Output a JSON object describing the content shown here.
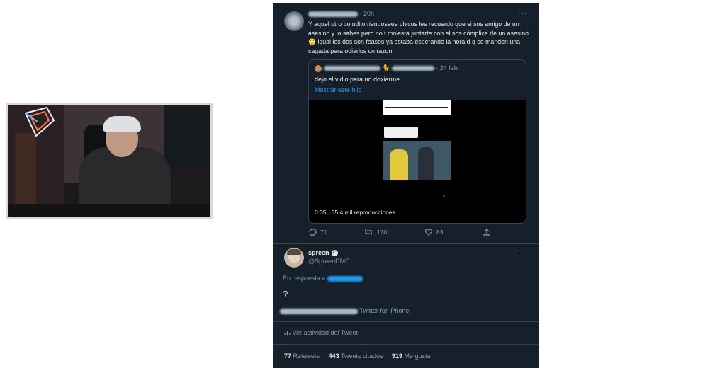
{
  "webcam": {
    "description_icon": "webcam-overlay"
  },
  "tweet": {
    "time": "· 20h",
    "text": "Y aquel otro boludito riendoseee chicos les recuerdo que si sos amigo de un asesino y lo sabes pero no t molesta juntarte con el sos cómplice de un asesino 🙄 igual los dos son feasos ya estaba esperando la hora d q se manden una cagada para odiarlos cn razon",
    "quote": {
      "date": "· 24 feb.",
      "emoji": "🐈",
      "text": "dejo el vidio para no doxiarme",
      "link": "Mostrar este hilo",
      "video_duration": "0:35",
      "video_views": "35,4 mil reproducciones",
      "tiktok_label": "TikTok"
    },
    "actions": {
      "replies": "71",
      "retweets": "170",
      "likes": "83"
    },
    "more": "···"
  },
  "reply": {
    "name": "spreen",
    "handle": "@SpreenDMC",
    "replying_to": "En respuesta a",
    "text": "?",
    "source": "Twitter for iPhone",
    "activity": "Ver actividad del Tweet",
    "more": "···",
    "stats": {
      "retweets_count": "77",
      "retweets_label": "Retweets",
      "quotes_count": "443",
      "quotes_label": "Tweets citados",
      "likes_count": "919",
      "likes_label": "Me gusta"
    }
  },
  "colors": {
    "panel_bg": "#15202b",
    "link": "#1d9bf0",
    "muted": "#8899a6"
  }
}
